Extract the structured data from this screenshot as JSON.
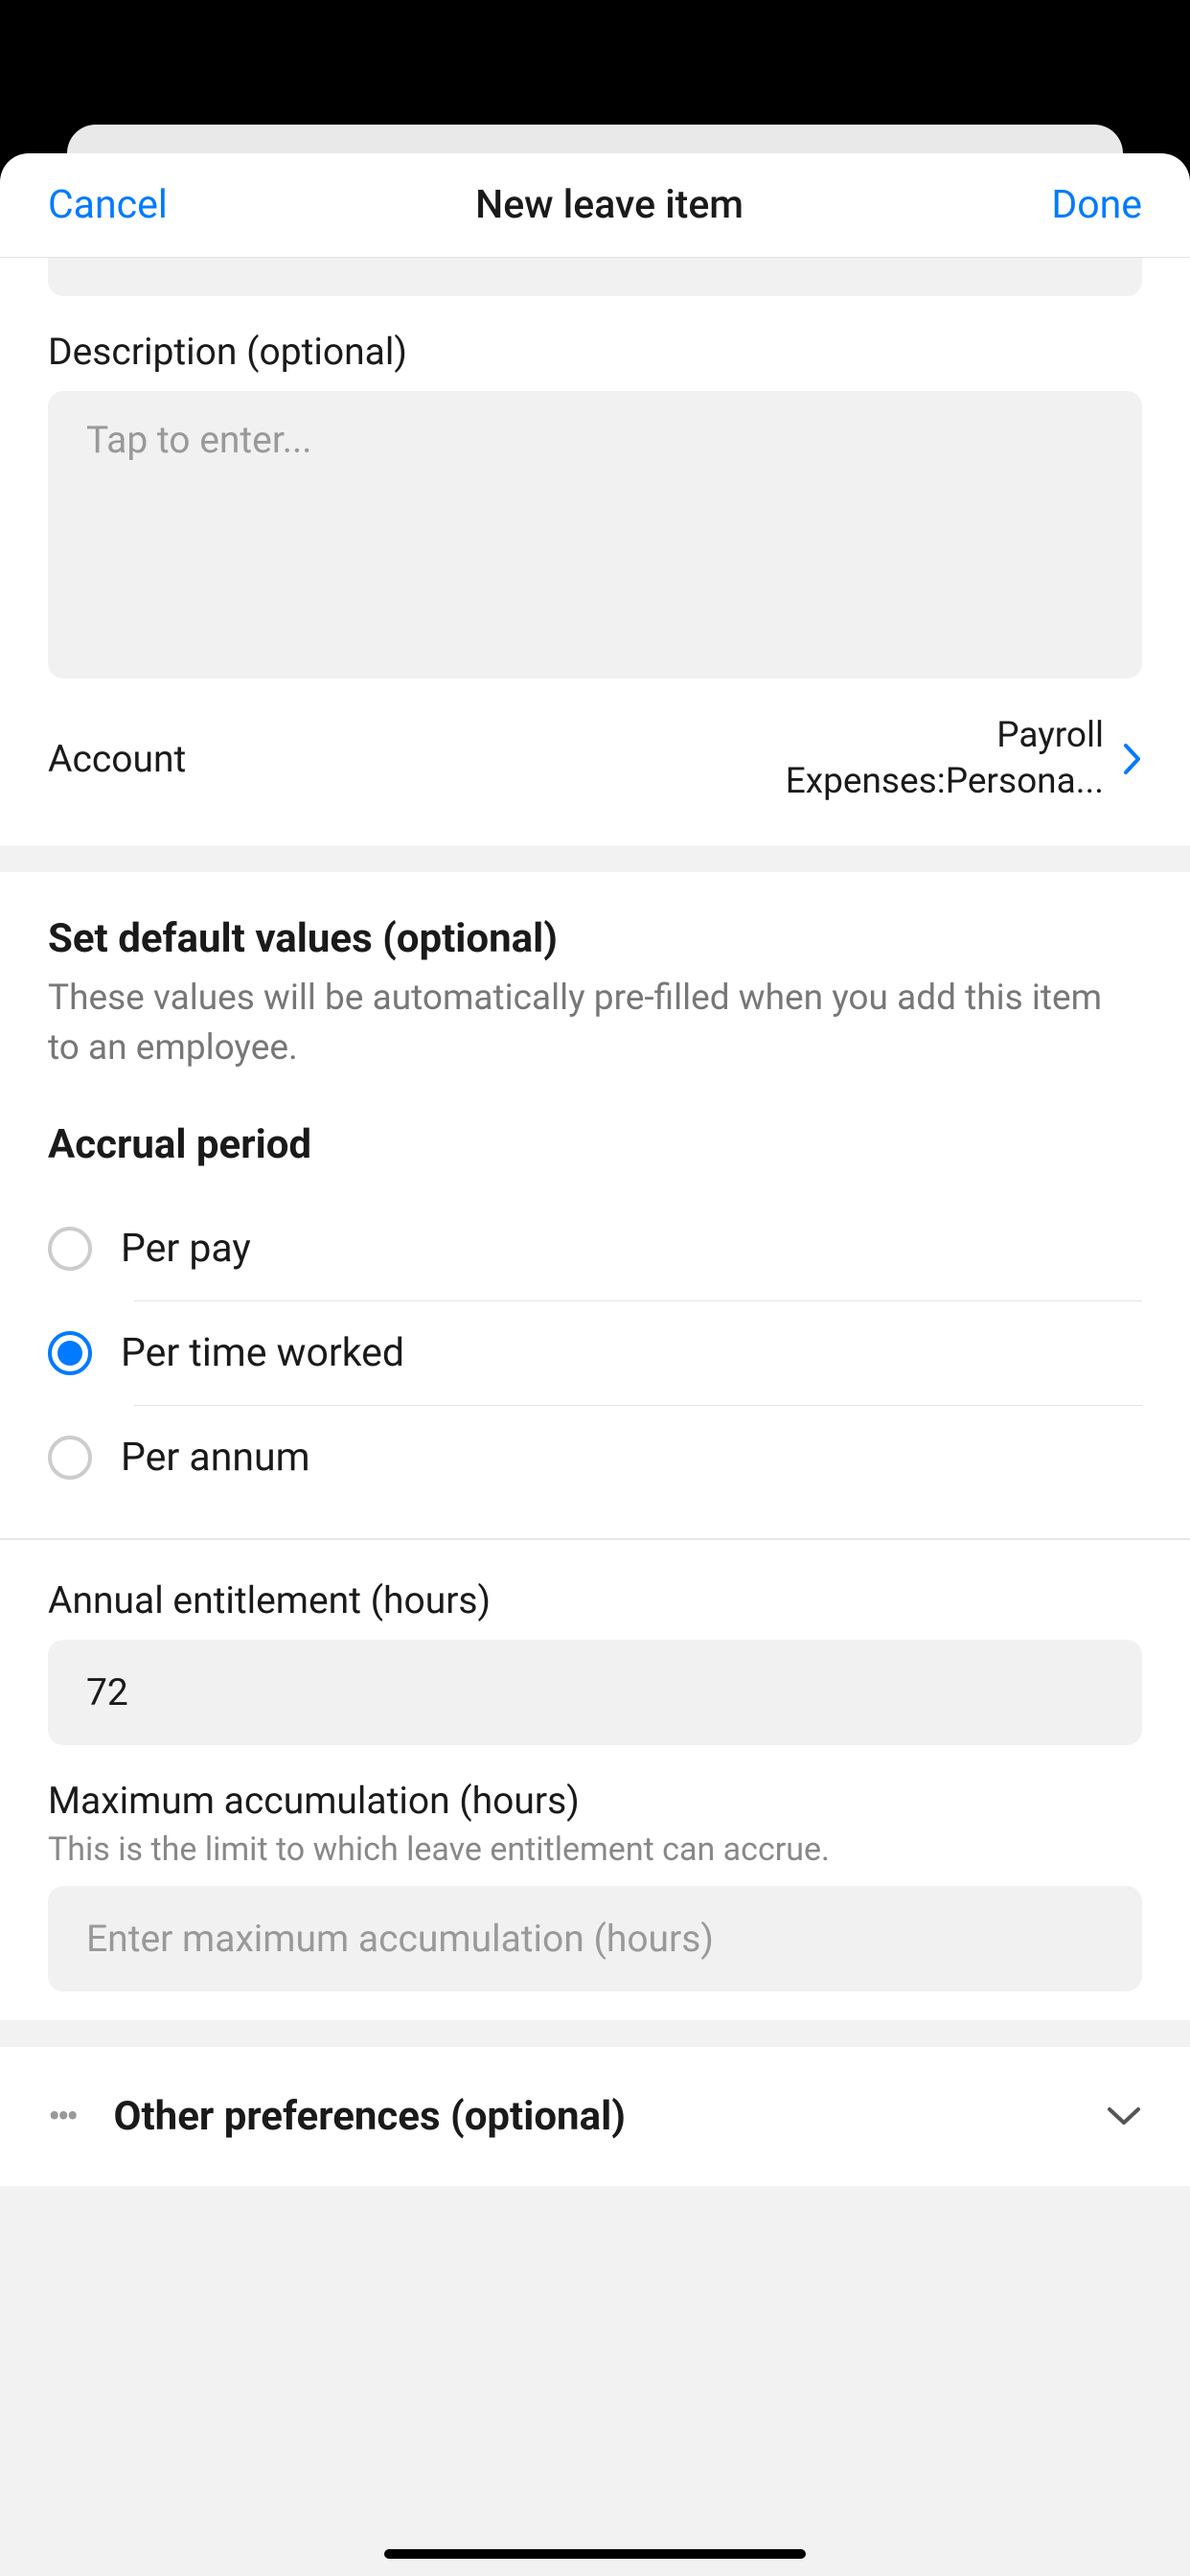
{
  "header": {
    "cancel": "Cancel",
    "title": "New leave item",
    "done": "Done"
  },
  "description": {
    "label": "Description (optional)",
    "placeholder": "Tap to enter...",
    "value": ""
  },
  "account": {
    "label": "Account",
    "value": "Payroll Expenses:Persona..."
  },
  "defaults": {
    "heading": "Set default values (optional)",
    "subtext": "These values will be automatically pre-filled when you add this item to an employee."
  },
  "accrual": {
    "heading": "Accrual period",
    "options": [
      {
        "label": "Per pay",
        "selected": false
      },
      {
        "label": "Per time worked",
        "selected": true
      },
      {
        "label": "Per annum",
        "selected": false
      }
    ]
  },
  "annual_entitlement": {
    "label": "Annual entitlement (hours)",
    "value": "72"
  },
  "max_accumulation": {
    "label": "Maximum accumulation (hours)",
    "subtext": "This is the limit to which leave entitlement can accrue.",
    "placeholder": "Enter maximum accumulation (hours)",
    "value": ""
  },
  "other_prefs": {
    "label": "Other preferences (optional)"
  }
}
